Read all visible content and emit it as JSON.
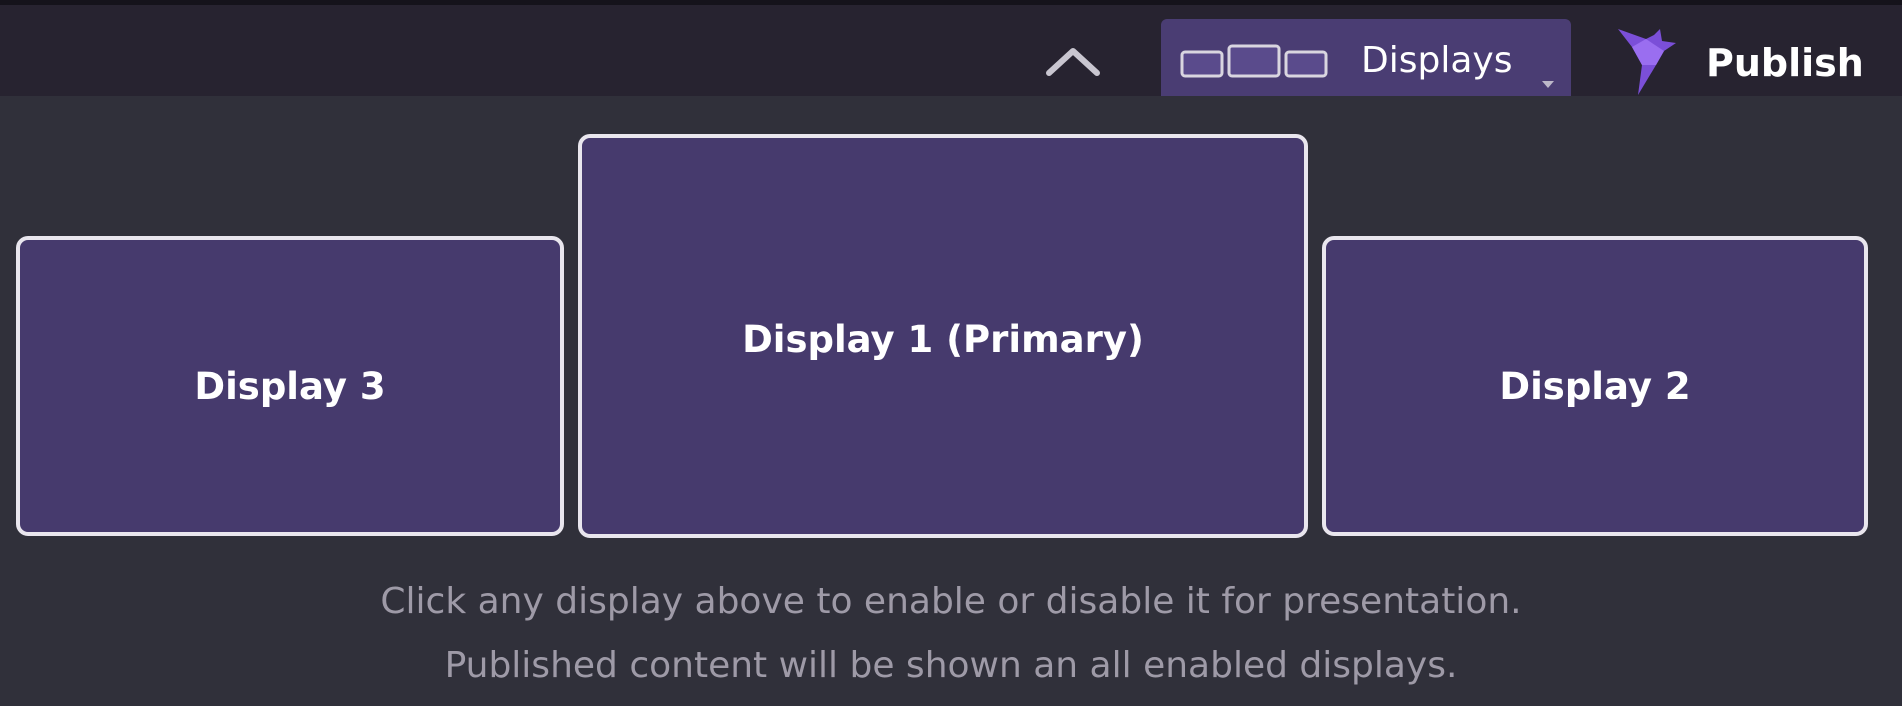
{
  "topbar": {
    "collapse_icon": "chevron-up-icon",
    "displays_button": {
      "icon": "monitors-icon",
      "label": "Displays",
      "caret": "caret-down-icon"
    },
    "publish_button": {
      "icon": "bird-logo-icon",
      "label": "Publish"
    }
  },
  "displays": [
    {
      "id": "display-3",
      "label": "Display 3"
    },
    {
      "id": "display-1",
      "label": "Display 1 (Primary)"
    },
    {
      "id": "display-2",
      "label": "Display 2"
    }
  ],
  "hint": {
    "line1": "Click any display above to enable or disable it for presentation.",
    "line2": "Published content will be shown an all enabled displays."
  },
  "colors": {
    "accent": "#4a3d73",
    "display_fill": "#463a6d",
    "display_border": "#e9e6ee",
    "logo": "#7b4fd8"
  }
}
